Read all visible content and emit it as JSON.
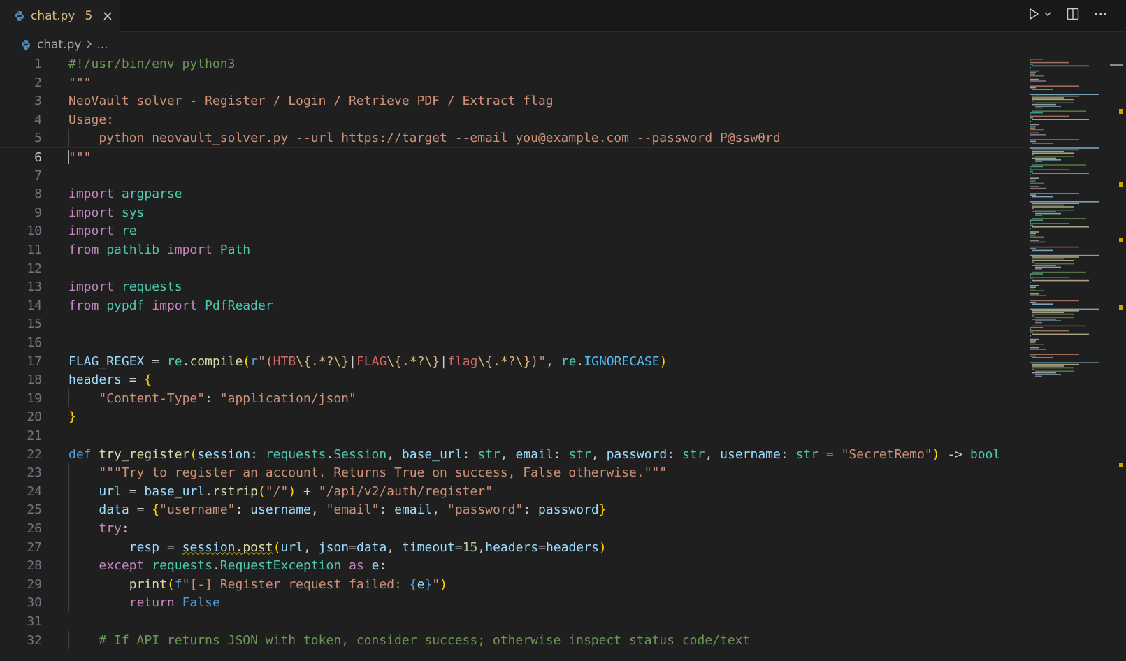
{
  "tab": {
    "filename": "chat.py",
    "problem_count": "5"
  },
  "breadcrumb": {
    "file": "chat.py",
    "more": "..."
  },
  "editor": {
    "line_numbers": [
      "1",
      "2",
      "3",
      "4",
      "5",
      "6",
      "7",
      "8",
      "9",
      "10",
      "11",
      "12",
      "13",
      "14",
      "15",
      "16",
      "17",
      "18",
      "19",
      "20",
      "21",
      "22",
      "23",
      "24",
      "25",
      "26",
      "27",
      "28",
      "29",
      "30",
      "31",
      "32"
    ],
    "active_line": 6,
    "lines": [
      "#!/usr/bin/env python3",
      "\"\"\"",
      "NeoVault solver - Register / Login / Retrieve PDF / Extract flag",
      "Usage:",
      "    python neovault_solver.py --url https://target --email you@example.com --password P@ssw0rd",
      "\"\"\"",
      "",
      "import argparse",
      "import sys",
      "import re",
      "from pathlib import Path",
      "",
      "import requests",
      "from pypdf import PdfReader",
      "",
      "",
      "FLAG_REGEX = re.compile(r\"(HTB\\{.*?\\}|FLAG\\{.*?\\}|flag\\{.*?\\})\", re.IGNORECASE)",
      "headers = {",
      "    \"Content-Type\": \"application/json\"",
      "}",
      "",
      "def try_register(session: requests.Session, base_url: str, email: str, password: str, username: str = \"SecretRemo\") -> bool",
      "    \"\"\"Try to register an account. Returns True on success, False otherwise.\"\"\"",
      "    url = base_url.rstrip(\"/\") + \"/api/v2/auth/register\"",
      "    data = {\"username\": username, \"email\": email, \"password\": password}",
      "    try:",
      "        resp = session.post(url, json=data, timeout=15,headers=headers)",
      "    except requests.RequestException as e:",
      "        print(f\"[-] Register request failed: {e}\")",
      "        return False",
      "",
      "    # If API returns JSON with token, consider success; otherwise inspect status code/text"
    ]
  },
  "icons": {
    "tab": [
      "python-file-icon",
      "close-icon"
    ],
    "actions": [
      "run-icon",
      "chevron-down-icon",
      "split-editor-icon",
      "more-icon"
    ],
    "breadcrumb": [
      "python-file-icon",
      "chevron-right-icon"
    ]
  },
  "colors": {
    "keyword": "#c586c0",
    "string": "#ce9178",
    "comment": "#6a9955",
    "warning": "#cca700",
    "tab_modified": "#d7ba7d"
  }
}
